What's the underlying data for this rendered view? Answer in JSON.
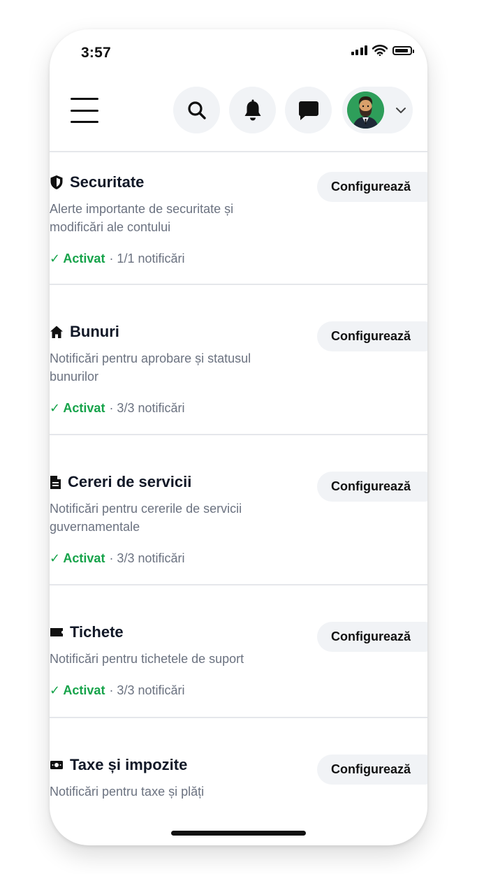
{
  "status_bar": {
    "time": "3:57"
  },
  "header": {
    "menu_icon": "hamburger-menu-icon",
    "search_icon": "search-icon",
    "notifications_icon": "bell-icon",
    "messages_icon": "chat-bubble-icon",
    "avatar_icon": "user-avatar",
    "dropdown_icon": "chevron-down-icon"
  },
  "categories": [
    {
      "icon": "shield-icon",
      "title": "Securitate",
      "description": "Alerte importante de securitate și modificări ale contului",
      "status_label": "✓ Activat",
      "status_detail": "· 1/1 notificări",
      "action_label": "Configurează"
    },
    {
      "icon": "home-icon",
      "title": "Bunuri",
      "description": "Notificări pentru aprobare și statusul bunurilor",
      "status_label": "✓ Activat",
      "status_detail": "· 3/3 notificări",
      "action_label": "Configurează"
    },
    {
      "icon": "document-icon",
      "title": "Cereri de servicii",
      "description": "Notificări pentru cererile de servicii guvernamentale",
      "status_label": "✓ Activat",
      "status_detail": "· 3/3 notificări",
      "action_label": "Configurează"
    },
    {
      "icon": "ticket-icon",
      "title": "Tichete",
      "description": "Notificări pentru tichetele de suport",
      "status_label": "✓ Activat",
      "status_detail": "· 3/3 notificări",
      "action_label": "Configurează"
    },
    {
      "icon": "money-icon",
      "title": "Taxe și impozite",
      "description": "Notificări pentru taxe și plăți",
      "status_label": "",
      "status_detail": "",
      "action_label": "Configurează"
    }
  ],
  "colors": {
    "active": "#16a34a",
    "muted_text": "#6b7280",
    "button_bg": "#f1f3f6",
    "avatar_bg": "#2e9e5a"
  }
}
